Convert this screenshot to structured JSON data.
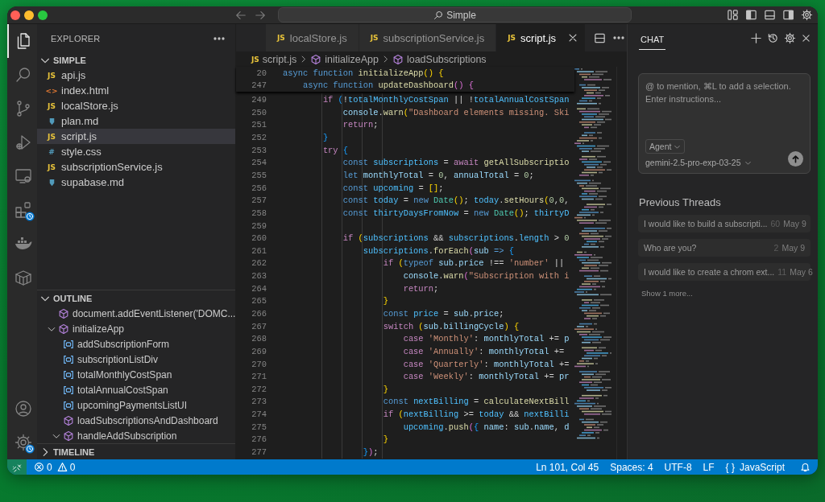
{
  "title_bar": {
    "search": "Simple"
  },
  "activity_bar": {
    "top": [
      {
        "selected": true,
        "badge": false
      },
      {
        "selected": false,
        "badge": false
      },
      {
        "selected": false,
        "badge": false
      },
      {
        "selected": false,
        "badge": false
      },
      {
        "selected": false,
        "badge": false
      },
      {
        "selected": false,
        "badge": true
      },
      {
        "selected": false,
        "badge": false
      },
      {
        "selected": false,
        "badge": false
      }
    ],
    "bottom": [
      {
        "selected": false,
        "badge": false
      },
      {
        "selected": false,
        "badge": true
      }
    ]
  },
  "sidebar": {
    "title": "EXPLORER",
    "folder": {
      "name": "SIMPLE",
      "expanded": true,
      "files": [
        {
          "name": "api.js",
          "kind": "js",
          "icon_text": "JS",
          "selected": false
        },
        {
          "name": "index.html",
          "kind": "html",
          "icon_text": "<>",
          "selected": false
        },
        {
          "name": "localStore.js",
          "kind": "js",
          "icon_text": "JS",
          "selected": false
        },
        {
          "name": "plan.md",
          "kind": "md",
          "selected": false
        },
        {
          "name": "script.js",
          "kind": "js",
          "icon_text": "JS",
          "selected": true
        },
        {
          "name": "style.css",
          "kind": "css",
          "icon_text": "#",
          "selected": false
        },
        {
          "name": "subscriptionService.js",
          "kind": "js",
          "icon_text": "JS",
          "selected": false
        },
        {
          "name": "supabase.md",
          "kind": "md",
          "selected": false
        }
      ]
    },
    "outline": {
      "title": "OUTLINE",
      "expanded": true,
      "items": [
        {
          "label": "document.addEventListener('DOMC...",
          "kind": "function"
        },
        {
          "label": "initializeApp",
          "kind": "function",
          "expanded": true,
          "children": [
            {
              "label": "addSubscriptionForm",
              "kind": "variable"
            },
            {
              "label": "subscriptionListDiv",
              "kind": "variable"
            },
            {
              "label": "totalMonthlyCostSpan",
              "kind": "variable"
            },
            {
              "label": "totalAnnualCostSpan",
              "kind": "variable"
            },
            {
              "label": "upcomingPaymentsListUI",
              "kind": "variable"
            },
            {
              "label": "loadSubscriptionsAndDashboard",
              "kind": "function"
            },
            {
              "label": "handleAddSubscription",
              "kind": "function",
              "expanded": true
            }
          ]
        }
      ]
    },
    "timeline": {
      "title": "TIMELINE",
      "expanded": false
    }
  },
  "editor": {
    "tabs": [
      {
        "label": "localStore.js",
        "icon_text": "JS",
        "selected": false
      },
      {
        "label": "subscriptionService.js",
        "icon_text": "JS",
        "selected": false
      },
      {
        "label": "script.js",
        "icon_text": "JS",
        "selected": true
      }
    ],
    "breadcrumb": [
      {
        "label": "script.js",
        "kind": "file",
        "icon_text": "JS"
      },
      {
        "label": "initializeApp",
        "kind": "function"
      },
      {
        "label": "loadSubscriptions",
        "kind": "function"
      }
    ],
    "sticky_lines": [
      {
        "number": "20",
        "tokens": [
          {
            "text": "async function",
            "kind": "storage"
          },
          {
            "text": " initializeApp",
            "kind": "function"
          },
          {
            "text": "() {",
            "kind": "bracket1"
          }
        ]
      },
      {
        "number": "247",
        "tokens": [
          {
            "text": "    async function",
            "kind": "storage"
          },
          {
            "text": " updateDashboard",
            "kind": "function"
          },
          {
            "text": "() {",
            "kind": "bracket2"
          }
        ]
      }
    ],
    "lines": [
      {
        "number": "249",
        "tokens": [
          {
            "text": "        if",
            "kind": "keyword"
          },
          {
            "text": " (",
            "kind": "bracket3"
          },
          {
            "text": "!",
            "kind": "plain"
          },
          {
            "text": "totalMonthlyCostSpan",
            "kind": "constant"
          },
          {
            "text": " || !",
            "kind": "plain"
          },
          {
            "text": "totalAnnualCostSpan",
            "kind": "constant"
          }
        ]
      },
      {
        "number": "250",
        "tokens": [
          {
            "text": "            console",
            "kind": "variable"
          },
          {
            "text": ".",
            "kind": "plain"
          },
          {
            "text": "warn",
            "kind": "function"
          },
          {
            "text": "(",
            "kind": "bracket1"
          },
          {
            "text": "\"Dashboard elements missing. Ski",
            "kind": "string"
          }
        ]
      },
      {
        "number": "251",
        "tokens": [
          {
            "text": "            return",
            "kind": "keyword"
          },
          {
            "text": ";",
            "kind": "plain"
          }
        ]
      },
      {
        "number": "252",
        "tokens": [
          {
            "text": "        }",
            "kind": "bracket3"
          }
        ]
      },
      {
        "number": "253",
        "tokens": [
          {
            "text": "        try",
            "kind": "keyword"
          },
          {
            "text": " {",
            "kind": "bracket3"
          }
        ]
      },
      {
        "number": "254",
        "tokens": [
          {
            "text": "            const",
            "kind": "storage"
          },
          {
            "text": " subscriptions",
            "kind": "constant"
          },
          {
            "text": " = ",
            "kind": "plain"
          },
          {
            "text": "await",
            "kind": "keyword"
          },
          {
            "text": " getAllSubscriptio",
            "kind": "function"
          }
        ]
      },
      {
        "number": "255",
        "tokens": [
          {
            "text": "            let",
            "kind": "storage"
          },
          {
            "text": " monthlyTotal",
            "kind": "variable"
          },
          {
            "text": " = ",
            "kind": "plain"
          },
          {
            "text": "0",
            "kind": "number"
          },
          {
            "text": ", ",
            "kind": "plain"
          },
          {
            "text": "annualTotal",
            "kind": "variable"
          },
          {
            "text": " = ",
            "kind": "plain"
          },
          {
            "text": "0",
            "kind": "number"
          },
          {
            "text": ";",
            "kind": "plain"
          }
        ]
      },
      {
        "number": "256",
        "tokens": [
          {
            "text": "            const",
            "kind": "storage"
          },
          {
            "text": " upcoming",
            "kind": "constant"
          },
          {
            "text": " = ",
            "kind": "plain"
          },
          {
            "text": "[]",
            "kind": "bracket1"
          },
          {
            "text": ";",
            "kind": "plain"
          }
        ]
      },
      {
        "number": "257",
        "tokens": [
          {
            "text": "            const",
            "kind": "storage"
          },
          {
            "text": " today",
            "kind": "constant"
          },
          {
            "text": " = ",
            "kind": "plain"
          },
          {
            "text": "new",
            "kind": "storage"
          },
          {
            "text": " Date",
            "kind": "type"
          },
          {
            "text": "()",
            "kind": "bracket1"
          },
          {
            "text": "; ",
            "kind": "plain"
          },
          {
            "text": "today",
            "kind": "constant"
          },
          {
            "text": ".",
            "kind": "plain"
          },
          {
            "text": "setHours",
            "kind": "function"
          },
          {
            "text": "(",
            "kind": "bracket1"
          },
          {
            "text": "0",
            "kind": "number"
          },
          {
            "text": ",",
            "kind": "plain"
          },
          {
            "text": "0",
            "kind": "number"
          },
          {
            "text": ",",
            "kind": "plain"
          }
        ]
      },
      {
        "number": "258",
        "tokens": [
          {
            "text": "            const",
            "kind": "storage"
          },
          {
            "text": " thirtyDaysFromNow",
            "kind": "constant"
          },
          {
            "text": " = ",
            "kind": "plain"
          },
          {
            "text": "new",
            "kind": "storage"
          },
          {
            "text": " Date",
            "kind": "type"
          },
          {
            "text": "()",
            "kind": "bracket1"
          },
          {
            "text": "; ",
            "kind": "plain"
          },
          {
            "text": "thirtyD",
            "kind": "constant"
          }
        ]
      },
      {
        "number": "259"
      },
      {
        "number": "260",
        "tokens": [
          {
            "text": "            if",
            "kind": "keyword"
          },
          {
            "text": " (",
            "kind": "bracket1"
          },
          {
            "text": "subscriptions",
            "kind": "constant"
          },
          {
            "text": " && ",
            "kind": "plain"
          },
          {
            "text": "subscriptions",
            "kind": "constant"
          },
          {
            "text": ".",
            "kind": "plain"
          },
          {
            "text": "length",
            "kind": "constant"
          },
          {
            "text": " > ",
            "kind": "plain"
          },
          {
            "text": "0",
            "kind": "number"
          }
        ]
      },
      {
        "number": "261",
        "tokens": [
          {
            "text": "                subscriptions",
            "kind": "constant"
          },
          {
            "text": ".",
            "kind": "plain"
          },
          {
            "text": "forEach",
            "kind": "function"
          },
          {
            "text": "(",
            "kind": "bracket2"
          },
          {
            "text": "sub",
            "kind": "variable"
          },
          {
            "text": " => ",
            "kind": "storage"
          },
          {
            "text": "{",
            "kind": "bracket3"
          }
        ]
      },
      {
        "number": "262",
        "tokens": [
          {
            "text": "                    if",
            "kind": "keyword"
          },
          {
            "text": " (",
            "kind": "bracket1"
          },
          {
            "text": "typeof",
            "kind": "storage"
          },
          {
            "text": " sub",
            "kind": "variable"
          },
          {
            "text": ".",
            "kind": "plain"
          },
          {
            "text": "price",
            "kind": "variable"
          },
          {
            "text": " !== ",
            "kind": "plain"
          },
          {
            "text": "'number'",
            "kind": "string"
          },
          {
            "text": " ||",
            "kind": "plain"
          }
        ]
      },
      {
        "number": "263",
        "tokens": [
          {
            "text": "                        console",
            "kind": "variable"
          },
          {
            "text": ".",
            "kind": "plain"
          },
          {
            "text": "warn",
            "kind": "function"
          },
          {
            "text": "(",
            "kind": "bracket2"
          },
          {
            "text": "\"Subscription with i",
            "kind": "string"
          }
        ]
      },
      {
        "number": "264",
        "tokens": [
          {
            "text": "                        return",
            "kind": "keyword"
          },
          {
            "text": ";",
            "kind": "plain"
          }
        ]
      },
      {
        "number": "265",
        "tokens": [
          {
            "text": "                    }",
            "kind": "bracket1"
          }
        ]
      },
      {
        "number": "266",
        "tokens": [
          {
            "text": "                    const",
            "kind": "storage"
          },
          {
            "text": " price",
            "kind": "constant"
          },
          {
            "text": " = ",
            "kind": "plain"
          },
          {
            "text": "sub",
            "kind": "variable"
          },
          {
            "text": ".",
            "kind": "plain"
          },
          {
            "text": "price",
            "kind": "variable"
          },
          {
            "text": ";",
            "kind": "plain"
          }
        ]
      },
      {
        "number": "267",
        "tokens": [
          {
            "text": "                    switch",
            "kind": "keyword"
          },
          {
            "text": " (",
            "kind": "bracket1"
          },
          {
            "text": "sub",
            "kind": "variable"
          },
          {
            "text": ".",
            "kind": "plain"
          },
          {
            "text": "billingCycle",
            "kind": "variable"
          },
          {
            "text": ")",
            "kind": "bracket1"
          },
          {
            "text": " {",
            "kind": "bracket1"
          }
        ]
      },
      {
        "number": "268",
        "tokens": [
          {
            "text": "                        case",
            "kind": "keyword"
          },
          {
            "text": " 'Monthly'",
            "kind": "string"
          },
          {
            "text": ": ",
            "kind": "plain"
          },
          {
            "text": "monthlyTotal",
            "kind": "variable"
          },
          {
            "text": " += ",
            "kind": "plain"
          },
          {
            "text": "p",
            "kind": "variable"
          }
        ]
      },
      {
        "number": "269",
        "tokens": [
          {
            "text": "                        case",
            "kind": "keyword"
          },
          {
            "text": " 'Annually'",
            "kind": "string"
          },
          {
            "text": ": ",
            "kind": "plain"
          },
          {
            "text": "monthlyTotal",
            "kind": "variable"
          },
          {
            "text": " +=",
            "kind": "plain"
          }
        ]
      },
      {
        "number": "270",
        "tokens": [
          {
            "text": "                        case",
            "kind": "keyword"
          },
          {
            "text": " 'Quarterly'",
            "kind": "string"
          },
          {
            "text": ": ",
            "kind": "plain"
          },
          {
            "text": "monthlyTotal",
            "kind": "variable"
          },
          {
            "text": " +=",
            "kind": "plain"
          }
        ]
      },
      {
        "number": "271",
        "tokens": [
          {
            "text": "                        case",
            "kind": "keyword"
          },
          {
            "text": " 'Weekly'",
            "kind": "string"
          },
          {
            "text": ": ",
            "kind": "plain"
          },
          {
            "text": "monthlyTotal",
            "kind": "variable"
          },
          {
            "text": " += ",
            "kind": "plain"
          },
          {
            "text": "pr",
            "kind": "variable"
          }
        ]
      },
      {
        "number": "272",
        "tokens": [
          {
            "text": "                    }",
            "kind": "bracket1"
          }
        ]
      },
      {
        "number": "273",
        "tokens": [
          {
            "text": "                    const",
            "kind": "storage"
          },
          {
            "text": " nextBilling",
            "kind": "constant"
          },
          {
            "text": " = ",
            "kind": "plain"
          },
          {
            "text": "calculateNextBill",
            "kind": "function"
          }
        ]
      },
      {
        "number": "274",
        "tokens": [
          {
            "text": "                    if",
            "kind": "keyword"
          },
          {
            "text": " (",
            "kind": "bracket1"
          },
          {
            "text": "nextBilling",
            "kind": "constant"
          },
          {
            "text": " >= ",
            "kind": "plain"
          },
          {
            "text": "today",
            "kind": "constant"
          },
          {
            "text": " && ",
            "kind": "plain"
          },
          {
            "text": "nextBilli",
            "kind": "constant"
          }
        ]
      },
      {
        "number": "275",
        "tokens": [
          {
            "text": "                        upcoming",
            "kind": "constant"
          },
          {
            "text": ".",
            "kind": "plain"
          },
          {
            "text": "push",
            "kind": "function"
          },
          {
            "text": "(",
            "kind": "bracket2"
          },
          {
            "text": "{ ",
            "kind": "bracket3"
          },
          {
            "text": "name",
            "kind": "variable"
          },
          {
            "text": ": ",
            "kind": "plain"
          },
          {
            "text": "sub",
            "kind": "variable"
          },
          {
            "text": ".",
            "kind": "plain"
          },
          {
            "text": "name",
            "kind": "variable"
          },
          {
            "text": ", ",
            "kind": "plain"
          },
          {
            "text": "d",
            "kind": "variable"
          }
        ]
      },
      {
        "number": "276",
        "tokens": [
          {
            "text": "                    }",
            "kind": "bracket1"
          }
        ]
      },
      {
        "number": "277",
        "tokens": [
          {
            "text": "                }",
            "kind": "bracket3"
          },
          {
            "text": ")",
            "kind": "bracket2"
          },
          {
            "text": ";",
            "kind": "plain"
          }
        ]
      }
    ]
  },
  "chat": {
    "title": "CHAT",
    "placeholder": "@ to mention, ⌘L to add a selection. Enter instructions...",
    "mode": "Agent",
    "model": "gemini-2.5-pro-exp-03-25",
    "threads_title": "Previous Threads",
    "threads": [
      {
        "title": "I would like to build a subscripti...",
        "count": "60",
        "date": "May 9"
      },
      {
        "title": "Who are you?",
        "count": "2",
        "date": "May 9"
      },
      {
        "title": "I would like to create a chrom ext...",
        "count": "11",
        "date": "May 6"
      }
    ],
    "show_more": "Show 1 more..."
  },
  "status_bar": {
    "errors": "0",
    "warnings": "0",
    "items": [
      {
        "label": "Ln 101, Col 45"
      },
      {
        "label": "Spaces: 4"
      },
      {
        "label": "UTF-8"
      },
      {
        "label": "LF"
      },
      {
        "label": "JavaScript",
        "icon_text": "{ }"
      }
    ]
  }
}
